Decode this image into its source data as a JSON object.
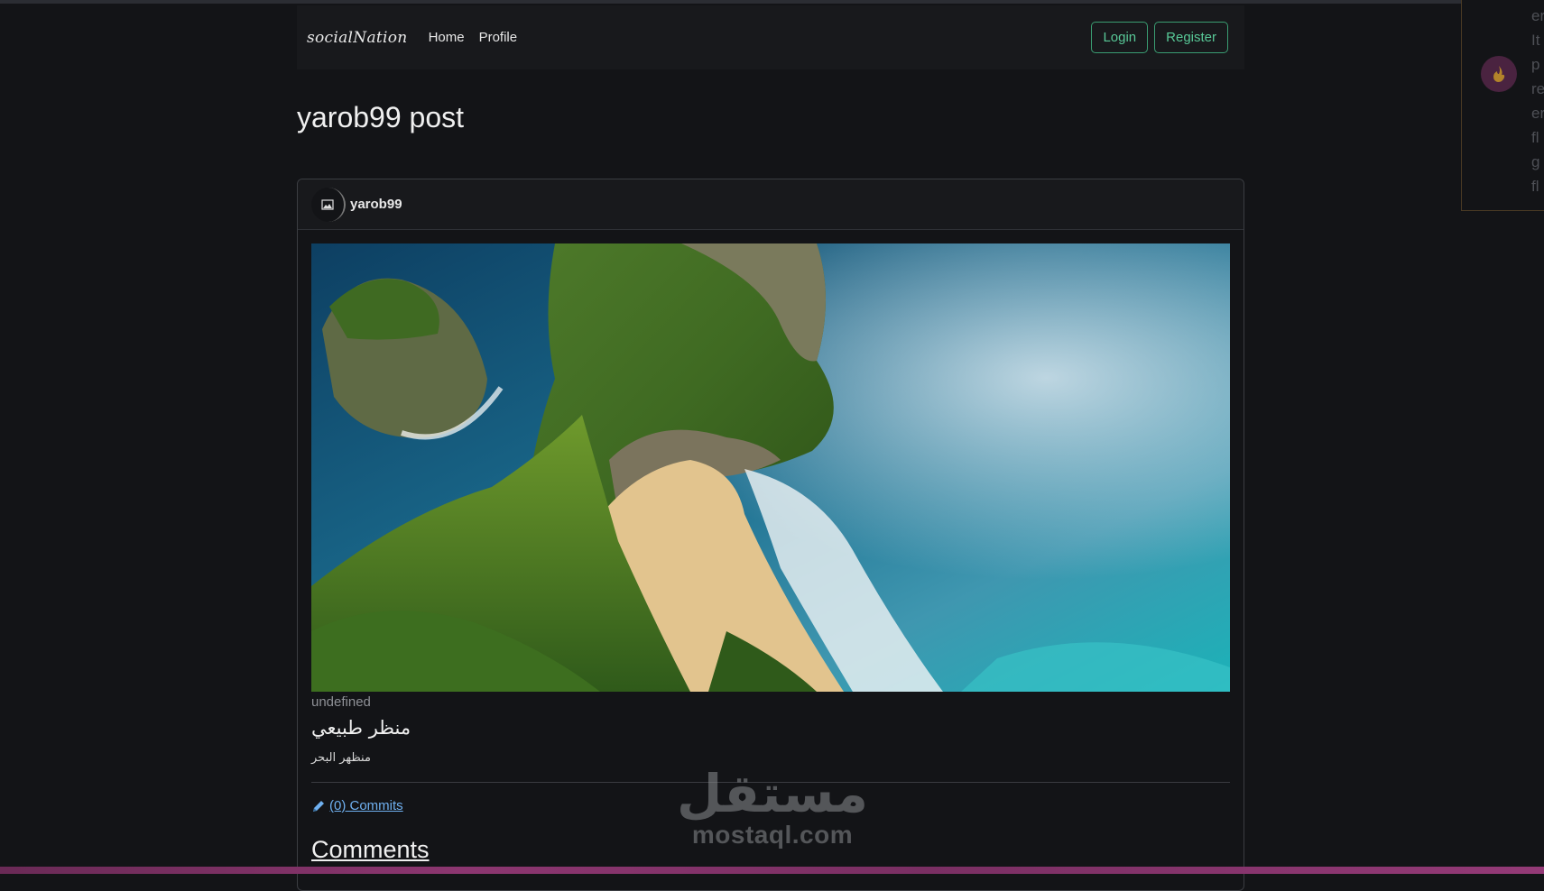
{
  "navbar": {
    "brand": "socialNation",
    "links": [
      "Home",
      "Profile"
    ],
    "login_label": "Login",
    "register_label": "Register"
  },
  "page": {
    "title": "yarob99 post"
  },
  "post": {
    "author": "yarob99",
    "image_alt": "landscape photo",
    "category": "undefined",
    "title": "منظر طبيعي",
    "body": "منظهر البحر",
    "commits_label": "(0) Commits",
    "comments_heading": "Comments"
  },
  "watermark": {
    "arabic": "مستقل",
    "latin": "mostaql.com"
  },
  "side_popup": {
    "text_lines": [
      "er",
      "It",
      "p",
      "re",
      "er",
      "fl",
      "g",
      "fl"
    ]
  },
  "colors": {
    "background": "#131417",
    "navbar": "#18191c",
    "accent_green": "#58c897",
    "link_blue": "#6fb0f0"
  }
}
